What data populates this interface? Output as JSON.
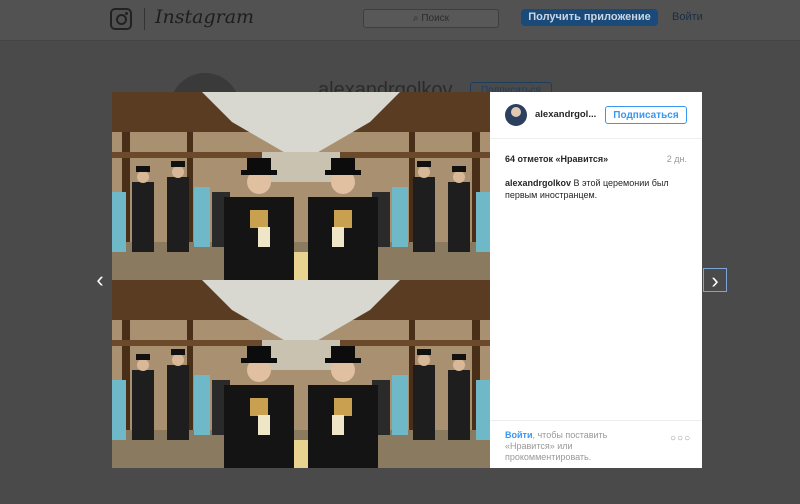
{
  "header": {
    "logo_icon": "instagram-camera-icon",
    "wordmark": "Instagram",
    "search_placeholder": "Поиск",
    "get_app_label": "Получить приложение",
    "login_label": "Войти"
  },
  "profile": {
    "username": "alexandrgolkov",
    "follow_label": "Подписаться"
  },
  "post": {
    "username": "alexandrgol...",
    "follow_label": "Подписаться",
    "likes": "64 отметок «Нравится»",
    "age": "2 дн.",
    "caption_user": "alexandrgolkov",
    "caption_text": " В этой церемонии был первым иностранцем.",
    "login_link": "Войти",
    "login_prompt": ", чтобы поставить «Нравится» или прокомментировать.",
    "more_icon": "ellipsis-icon"
  },
  "nav": {
    "prev_icon": "chevron-left-icon",
    "next_icon": "chevron-right-icon"
  },
  "colors": {
    "accent": "#3897f0",
    "overlay": "#4a4a4a"
  }
}
